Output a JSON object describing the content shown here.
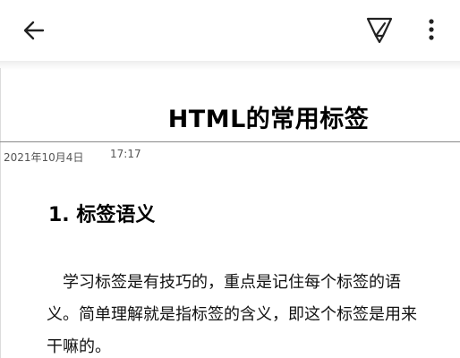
{
  "toolbar": {
    "back_icon": "arrow-left-icon",
    "pen_icon": "pen-icon",
    "more_icon": "more-vertical-icon"
  },
  "document": {
    "title": "HTML的常用标签",
    "date": "2021年10月4日",
    "time": "17:17",
    "section_heading": "1. 标签语义",
    "paragraph": "学习标签是有技巧的，重点是记住每个标签的语义。简单理解就是指标签的含义，即这个标签是用来干嘛的。"
  }
}
